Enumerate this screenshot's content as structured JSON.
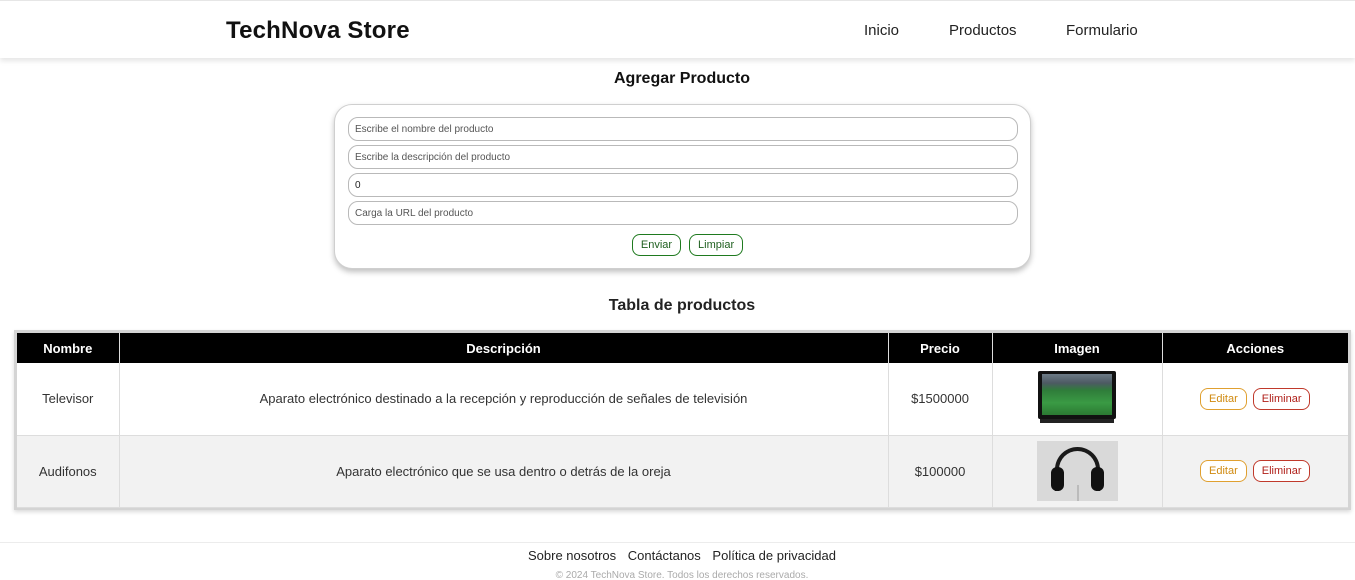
{
  "header": {
    "brand": "TechNova Store",
    "nav": [
      "Inicio",
      "Productos",
      "Formulario"
    ]
  },
  "form": {
    "title": "Agregar Producto",
    "name_placeholder": "Escribe el nombre del producto",
    "description_placeholder": "Escribe la descripción del producto",
    "price_value": "0",
    "url_placeholder": "Carga la URL del producto",
    "submit_label": "Enviar",
    "clear_label": "Limpiar"
  },
  "table": {
    "title": "Tabla de productos",
    "columns": [
      "Nombre",
      "Descripción",
      "Precio",
      "Imagen",
      "Acciones"
    ],
    "rows": [
      {
        "name": "Televisor",
        "description": "Aparato electrónico destinado a la recepción y reproducción de señales de televisión",
        "price": "$1500000",
        "image": "tv-image"
      },
      {
        "name": "Audifonos",
        "description": "Aparato electrónico que se usa dentro o detrás de la oreja",
        "price": "$100000",
        "image": "headphones-image"
      }
    ],
    "edit_label": "Editar",
    "delete_label": "Eliminar"
  },
  "footer": {
    "links": [
      "Sobre nosotros",
      "Contáctanos",
      "Política de privacidad"
    ],
    "copyright": "© 2024 TechNova Store. Todos los derechos reservados."
  },
  "colors": {
    "accent_green": "#1f7a1f",
    "edit_orange": "#e0a030",
    "delete_red": "#c0392b",
    "table_header": "#000000"
  }
}
